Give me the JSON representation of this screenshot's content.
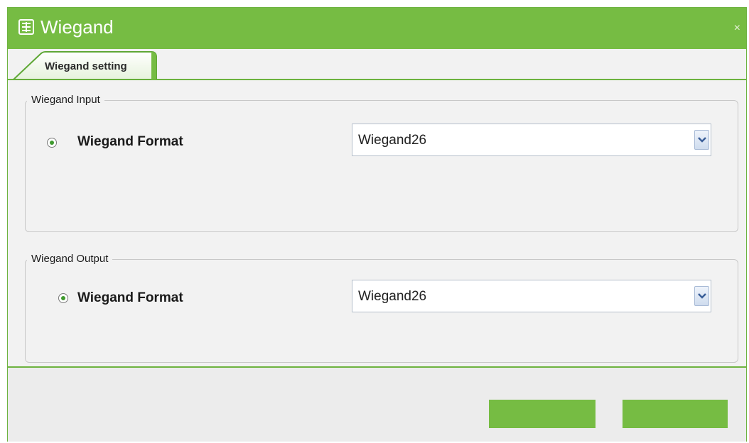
{
  "window": {
    "title": "Wiegand",
    "title_icon": "settings-window-icon",
    "close_icon": "close-icon",
    "close_glyph": "×",
    "accent_color": "#76bc43"
  },
  "tabs": [
    {
      "label": "Wiegand setting",
      "active": true
    }
  ],
  "wiegand_input": {
    "legend": "Wiegand Input",
    "row_label": "Wiegand Format",
    "radio_selected": true,
    "select_value": "Wiegand26"
  },
  "wiegand_output": {
    "legend": "Wiegand Output",
    "row_label": "Wiegand Format",
    "radio_selected": true,
    "select_value": "Wiegand26"
  },
  "footer": {
    "buttons": [
      {
        "label": ""
      },
      {
        "label": ""
      }
    ]
  }
}
